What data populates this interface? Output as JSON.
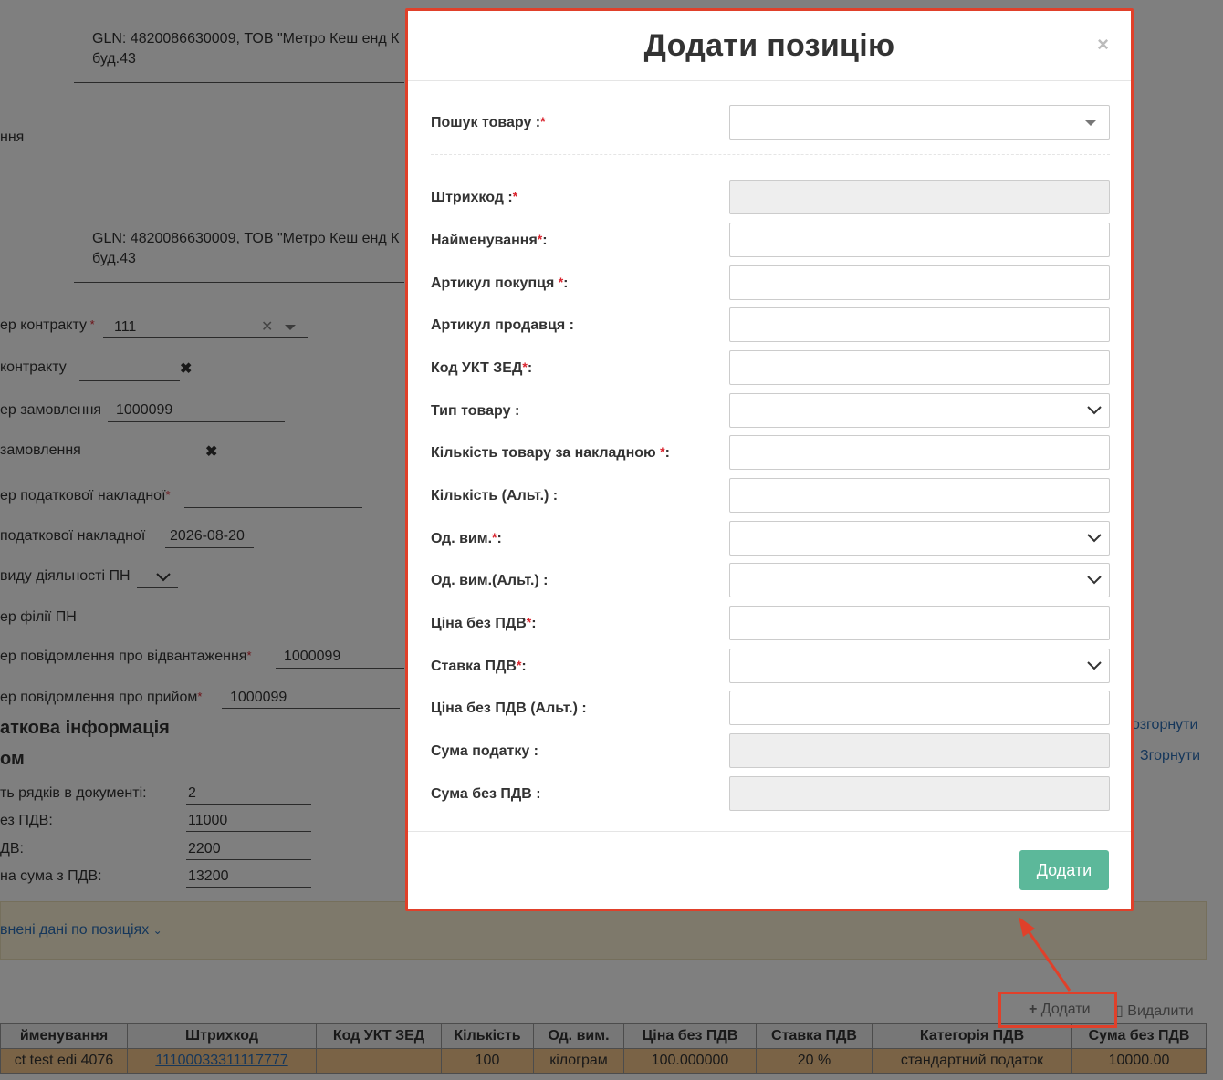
{
  "background": {
    "gln1": "GLN: 4820086630009, ТОВ \"Метро Кеш енд К",
    "gln1_line2": "буд.43",
    "label_nnya": "ння",
    "gln2": "GLN: 4820086630009, ТОВ \"Метро Кеш енд К",
    "gln2_line2": "буд.43",
    "contract_no_label": "ер контракту",
    "contract_no_value": "111",
    "contract_date_label": " контракту",
    "order_no_label": "ер замовлення",
    "order_no_value": "1000099",
    "order_date_label": " замовлення",
    "tax_invoice_no_label": "ер податкової накладної",
    "tax_invoice_date_label": " податкової накладної",
    "tax_invoice_date_value": "2026-08-20",
    "activity_label": "виду діяльності ПН",
    "branch_label": "ер філії ПН",
    "despatch_label": "ер повідомлення про відвантаження",
    "despatch_value": "1000099",
    "receipt_label": "ер повідомлення про прийом",
    "receipt_value": "1000099",
    "additional_info": "аткова інформація",
    "total_section": "ом",
    "expand_link": "озгорнути",
    "collapse_link": "Згорнути",
    "rows_count_label": "ть рядків в документі:",
    "rows_count_value": "2",
    "sum_no_vat_label": "ез ПДВ:",
    "sum_no_vat_value": "11000",
    "vat_label": "ДВ:",
    "vat_value": "2200",
    "total_with_vat_label": "на сума з ПДВ:",
    "total_with_vat_value": "13200",
    "position_data_link": "внені дані по позиціях",
    "add_link": "Додати",
    "delete_link": "Видалити"
  },
  "table": {
    "headers": [
      "йменування",
      "Штрихкод",
      "Код УКТ ЗЕД",
      "Кількість",
      "Од. вим.",
      "Ціна без ПДВ",
      "Ставка ПДВ",
      "Категорія ПДВ",
      "Сума без ПДВ"
    ],
    "rows": [
      [
        "ct test edi 4076",
        "11100033311117777",
        "",
        "100",
        "кілограм",
        "100.000000",
        "20 %",
        "стандартний податок",
        "10000.00"
      ]
    ]
  },
  "modal": {
    "title": "Додати позицію",
    "close": "×",
    "search_label": "Пошук товару :",
    "fields": [
      {
        "label": "Штрихкод :",
        "req": true
      },
      {
        "label": "Найменування",
        "req": true,
        "suffix": ":"
      },
      {
        "label": "Артикул покупця ",
        "req": true,
        "suffix": ":"
      },
      {
        "label": "Артикул продавця :",
        "req": false
      },
      {
        "label": "Код УКТ ЗЕД",
        "req": true,
        "suffix": ":"
      },
      {
        "label": "Тип товару :",
        "req": false
      },
      {
        "label": "Кількість товару за накладною ",
        "req": true,
        "suffix": ":"
      },
      {
        "label": "Кількість (Альт.) :",
        "req": false
      },
      {
        "label": "Од. вим.",
        "req": true,
        "suffix": ":"
      },
      {
        "label": "Од. вим.(Альт.) :",
        "req": false
      },
      {
        "label": "Ціна без ПДВ",
        "req": true,
        "suffix": ":"
      },
      {
        "label": "Ставка ПДВ",
        "req": true,
        "suffix": ":"
      },
      {
        "label": "Ціна без ПДВ (Альт.) :",
        "req": false
      },
      {
        "label": "Сума податку :",
        "req": false
      },
      {
        "label": "Сума без ПДВ :",
        "req": false
      }
    ],
    "submit_label": "Додати"
  },
  "colors": {
    "annotation": "#e0402a",
    "primary_button": "#5cb89a",
    "link": "#2c6fb7",
    "row_highlight": "#f4c68c"
  }
}
